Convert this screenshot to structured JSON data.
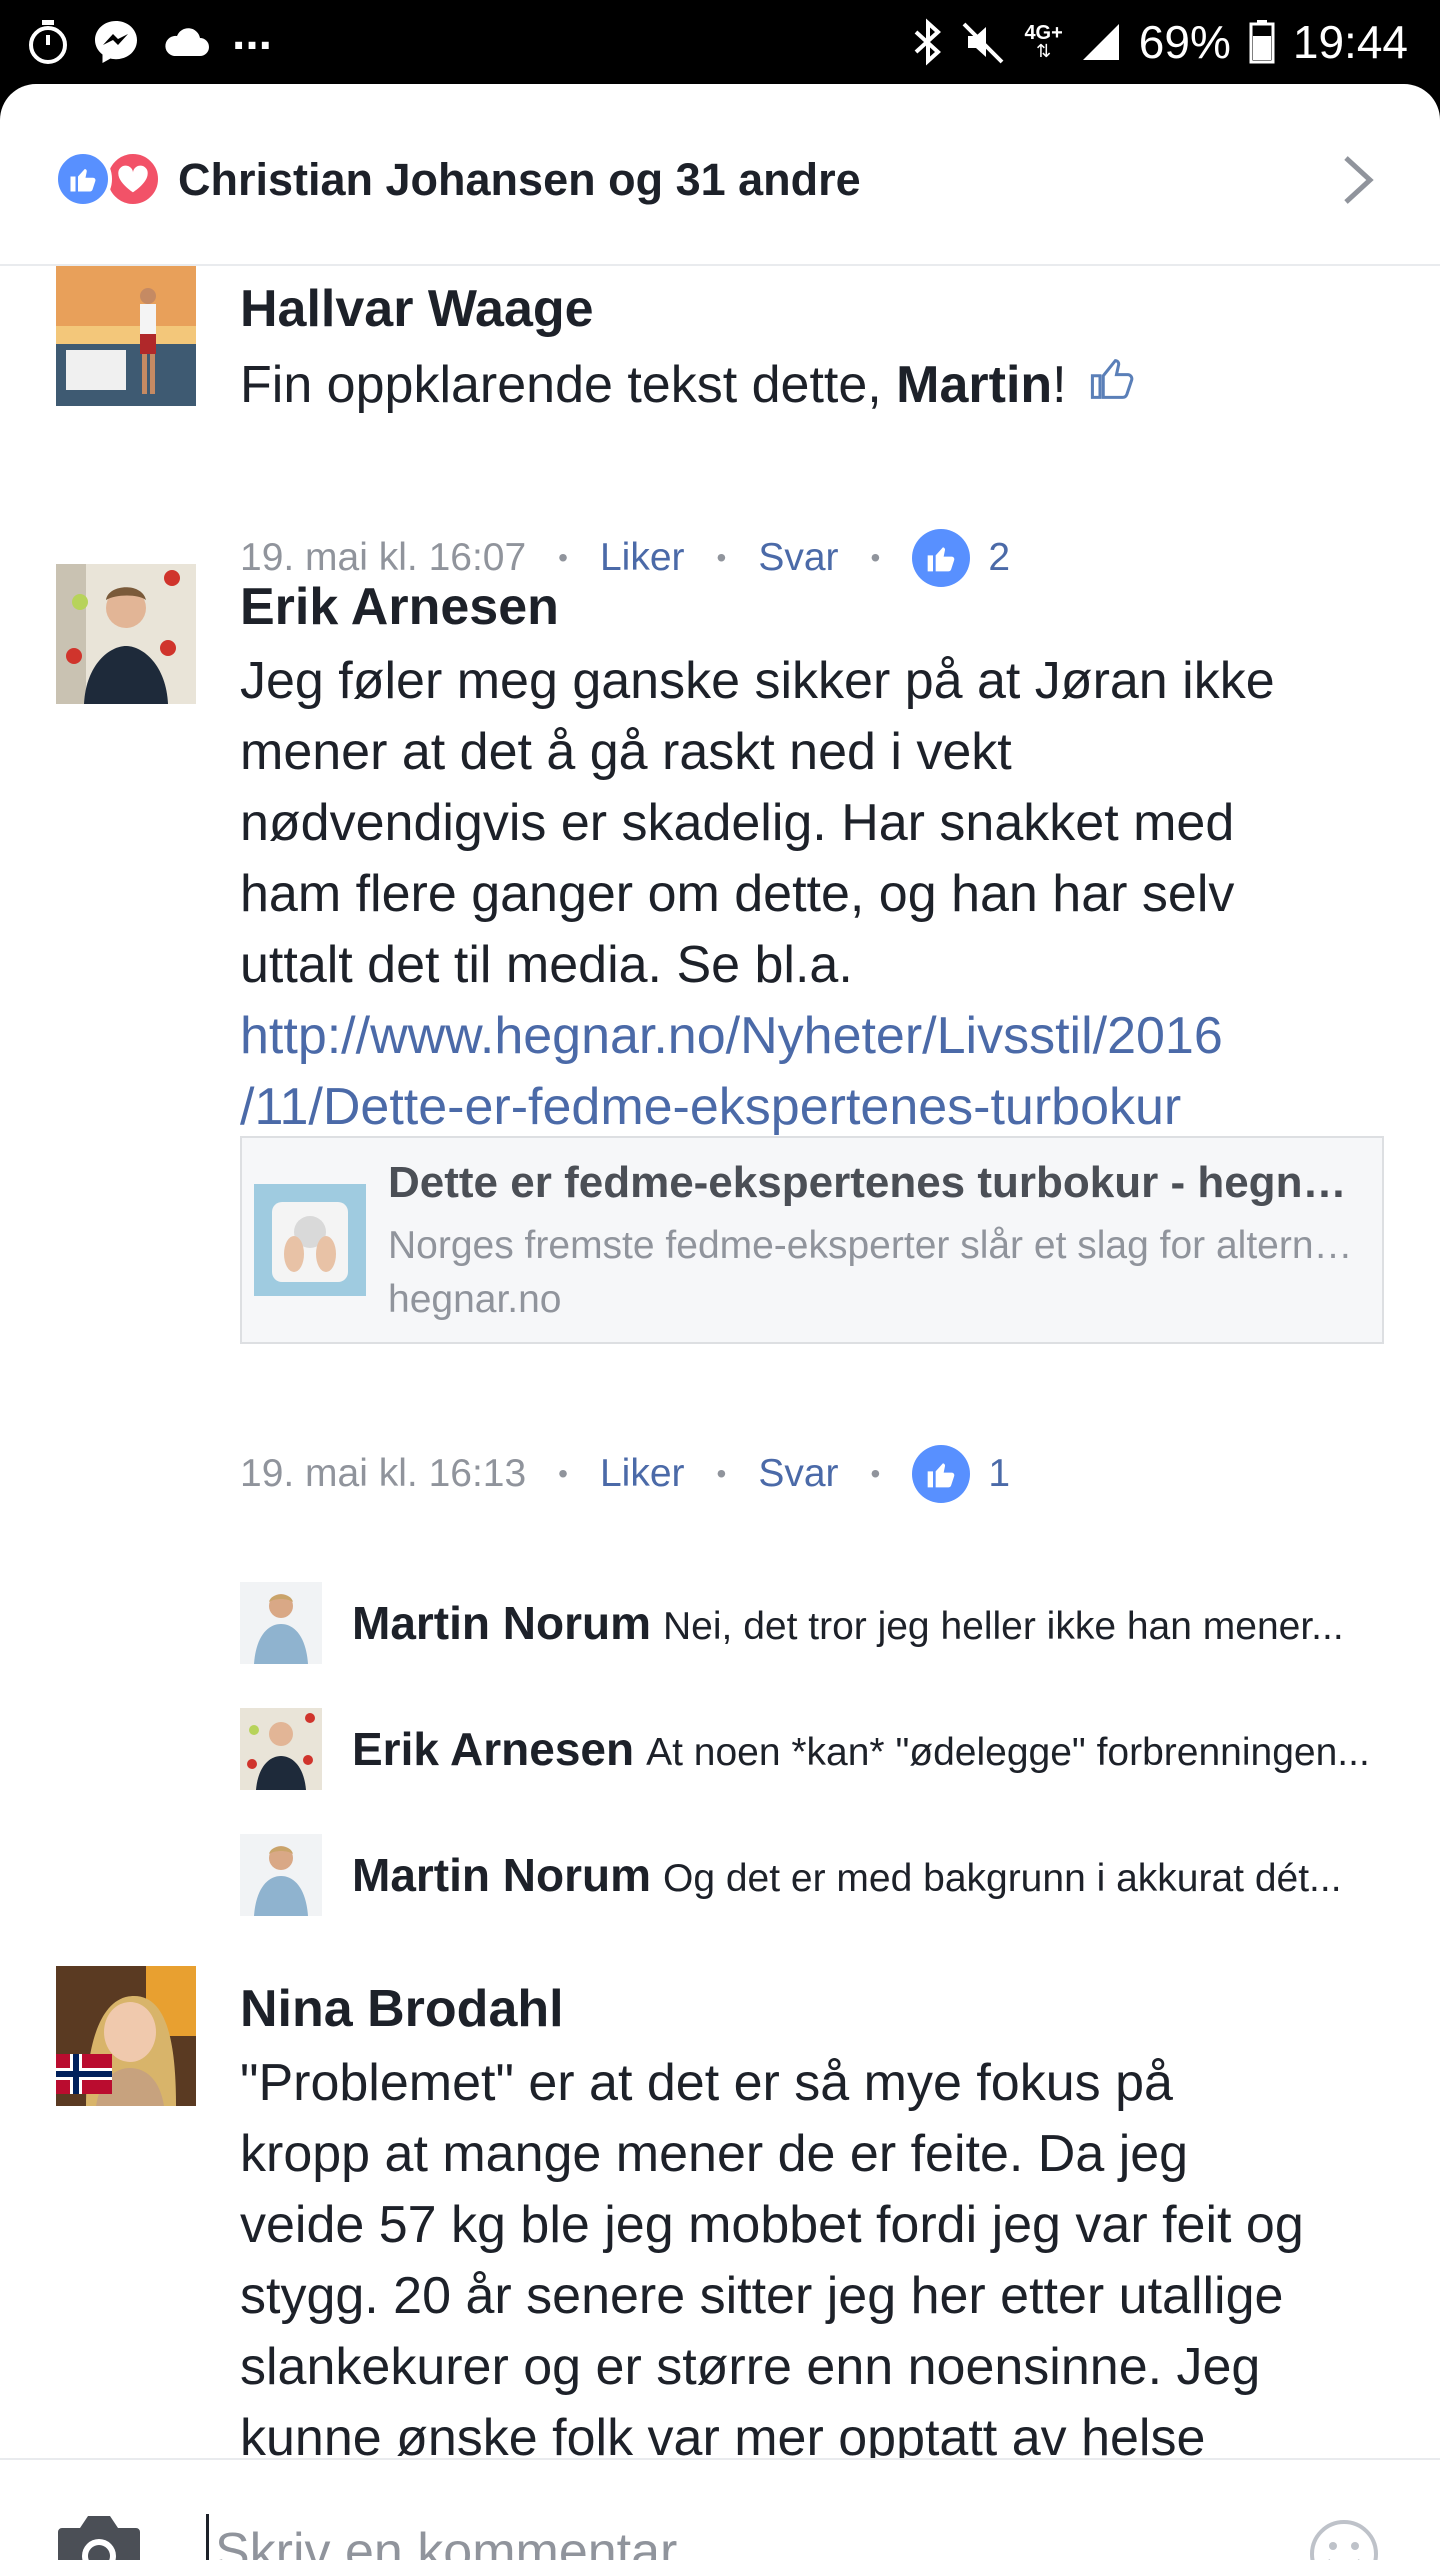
{
  "status_bar": {
    "battery": "69%",
    "time": "19:44",
    "network": "4G+",
    "icons": [
      "timer-icon",
      "messenger-icon",
      "cloud-icon",
      "bluetooth-icon",
      "mute-icon",
      "signal-icon",
      "battery-icon"
    ],
    "overflow": "..."
  },
  "reactions": {
    "text": "Christian Johansen og 31 andre",
    "icons": [
      "like-reaction-icon",
      "love-reaction-icon"
    ],
    "colors": {
      "like": "#5890ff",
      "love": "#f25268"
    }
  },
  "comments": [
    {
      "name": "Hallvar Waage",
      "text_before": "Fin oppklarende tekst dette, ",
      "mention": "Martin",
      "text_after": "!",
      "time": "19. mai kl. 16:07",
      "like_label": "Liker",
      "reply_label": "Svar",
      "like_count": "2"
    },
    {
      "name": "Erik Arnesen",
      "text_lines": [
        "Jeg føler meg ganske sikker på at Jøran ikke",
        "mener at det å gå raskt ned i vekt",
        "nødvendigvis er skadelig. Har snakket med",
        "ham flere ganger om dette, og han har selv",
        "uttalt det til media. Se bl.a."
      ],
      "link_lines": [
        "http://www.hegnar.no/Nyheter/Livsstil/2016",
        "/11/Dette-er-fedme-ekspertenes-turbokur"
      ],
      "preview": {
        "title": "Dette er fedme-ekspertenes turbokur - hegnar.no",
        "description": "Norges fremste fedme-eksperter slår et slag for alternativ",
        "domain": "hegnar.no"
      },
      "time": "19. mai kl. 16:13",
      "like_label": "Liker",
      "reply_label": "Svar",
      "like_count": "1",
      "replies": [
        {
          "name": "Martin Norum",
          "text": "Nei, det tror jeg heller ikke han mener..."
        },
        {
          "name": "Erik Arnesen",
          "text": "At noen *kan* \"ødelegge\" forbrenningen..."
        },
        {
          "name": "Martin Norum",
          "text": "Og det er med bakgrunn i akkurat dét..."
        }
      ]
    },
    {
      "name": "Nina Brodahl",
      "text_lines": [
        "\"Problemet\" er at det er så mye fokus på",
        "kropp at mange mener de er feite. Da jeg",
        "veide 57 kg ble jeg mobbet fordi jeg var feit og",
        "stygg. 20 år senere sitter jeg her etter utallige",
        "slankekurer og er større enn noensinne. Jeg",
        "kunne ønske folk var mer opptatt av helse"
      ]
    }
  ],
  "composer": {
    "placeholder": "Skriv en kommentar ...",
    "icons": [
      "camera-icon",
      "smiley-icon"
    ]
  },
  "colors": {
    "link": "#4b6aa8",
    "meta": "#90949c",
    "text": "#1d2129",
    "like_blue": "#5890ff"
  }
}
